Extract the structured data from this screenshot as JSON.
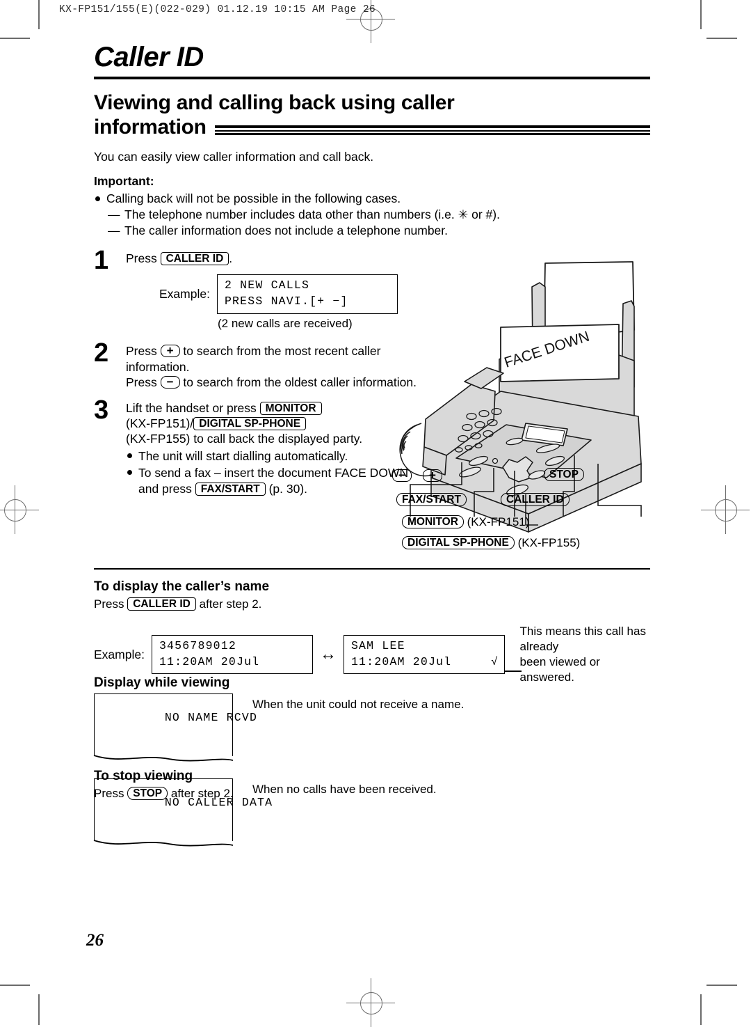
{
  "print_slug": "KX-FP151/155(E)(022-029)  01.12.19  10:15 AM  Page 26",
  "chapter_title": "Caller ID",
  "section_title_line1": "Viewing and calling back using caller",
  "section_title_line2": "information",
  "intro": "You can easily view caller information and call back.",
  "important_heading": "Important:",
  "important_bullets": [
    "Calling back will not be possible in the following cases.",
    "The telephone number includes data other than numbers (i.e. ✳ or #).",
    "The caller information does not include a telephone number."
  ],
  "steps": {
    "step1": {
      "num": "1",
      "press_label": "Press",
      "key": "CALLER ID",
      "period": ".",
      "example_label": "Example:",
      "lcd_line1": "2 NEW CALLS",
      "lcd_line2": "PRESS NAVI.[+ −]",
      "note": "(2 new calls are received)"
    },
    "step2": {
      "num": "2",
      "press_plus_pre": "Press",
      "key_plus": "+",
      "press_plus_post": "to search from the most recent caller information.",
      "press_minus_pre": "Press",
      "key_minus": "−",
      "press_minus_post": "to search from the oldest caller information."
    },
    "step3": {
      "num": "3",
      "line1_pre": "Lift the handset or press",
      "key_monitor": "MONITOR",
      "line2_pre": "(KX-FP151)/",
      "key_digital": "DIGITAL SP-PHONE",
      "line3": "(KX-FP155) to call back the displayed party.",
      "bullet1": "The unit will start dialling automatically.",
      "bullet2_pre": "To send a fax – insert the document FACE DOWN and press",
      "key_faxstart": "FAX/START",
      "bullet2_post": "(p. 30)."
    }
  },
  "illustration": {
    "face_down_label": "FACE DOWN",
    "callouts": {
      "minus": "−",
      "plus": "+",
      "stop": "STOP",
      "fax_start": "FAX/START",
      "caller_id": "CALLER ID",
      "monitor": "MONITOR",
      "monitor_model": "(KX-FP151)",
      "digital_sp_phone": "DIGITAL SP-PHONE",
      "digital_model": "(KX-FP155)"
    }
  },
  "caller_name_section": {
    "heading": "To display the caller’s name",
    "press_pre": "Press",
    "key": "CALLER ID",
    "press_post": "after step 2.",
    "example_label": "Example:",
    "lcd_left_line1": "3456789012",
    "lcd_left_line2": "11:20AM 20Jul",
    "arrow": "↔",
    "lcd_right_line1": "SAM LEE",
    "lcd_right_line2": "11:20AM 20Jul",
    "check_mark": "√",
    "callout_line1": "This means this call has already",
    "callout_line2": "been viewed or answered."
  },
  "display_while_viewing": {
    "heading": "Display while viewing",
    "rows": [
      {
        "lcd": "NO NAME RCVD",
        "desc": "When the unit could not receive a name."
      },
      {
        "lcd": "NO CALLER DATA",
        "desc": "When no calls have been received."
      }
    ]
  },
  "stop_viewing_section": {
    "heading": "To stop viewing",
    "press_pre": "Press",
    "key": "STOP",
    "press_post": "after step 2."
  },
  "page_number": "26"
}
